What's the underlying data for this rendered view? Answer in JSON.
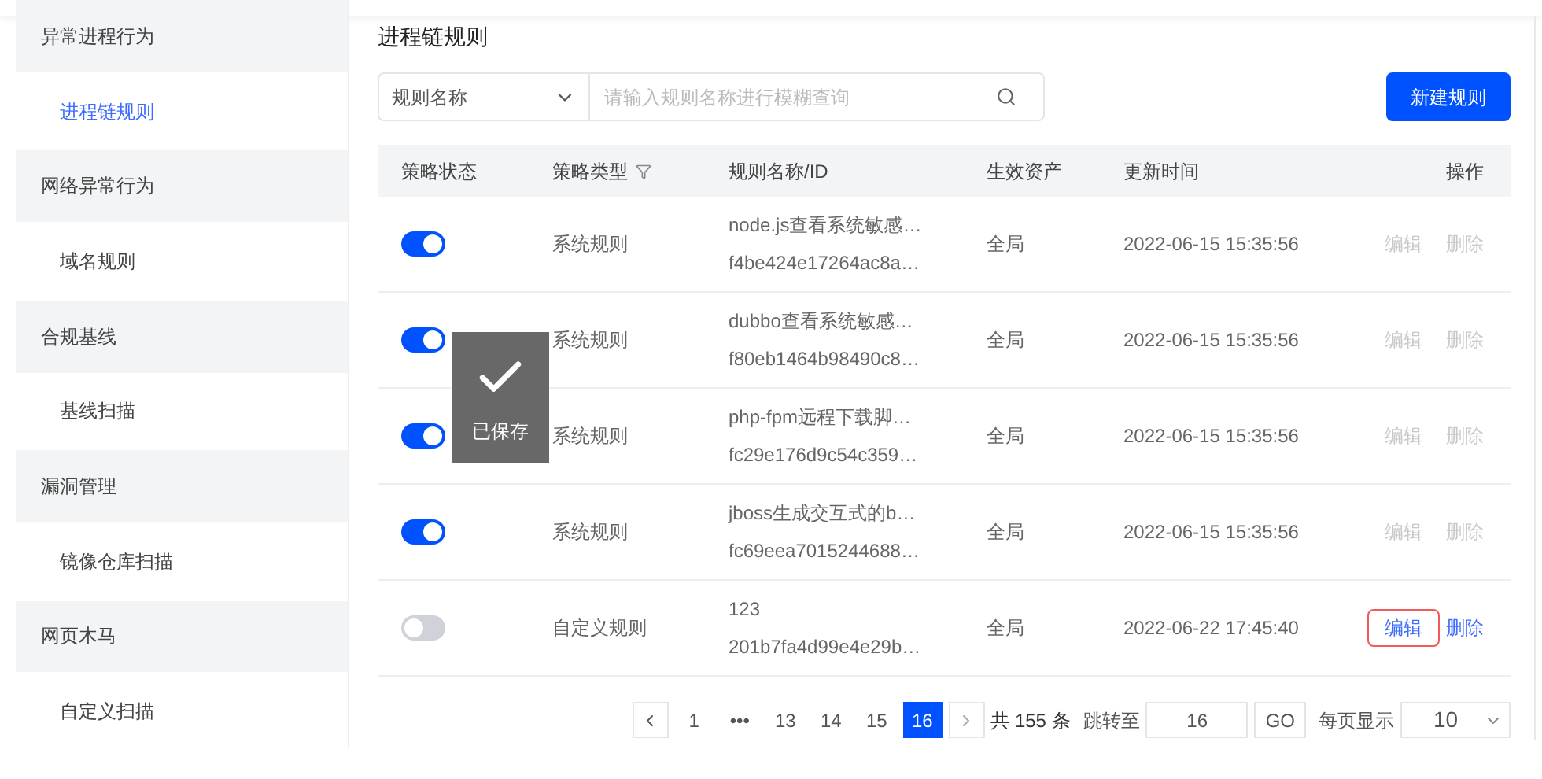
{
  "sidebar": {
    "items": [
      {
        "kind": "group",
        "label": "异常进程行为",
        "selected": false
      },
      {
        "kind": "child",
        "label": "进程链规则",
        "selected": true
      },
      {
        "kind": "group",
        "label": "网络异常行为",
        "selected": false
      },
      {
        "kind": "child",
        "label": "域名规则",
        "selected": false
      },
      {
        "kind": "group",
        "label": "合规基线",
        "selected": false
      },
      {
        "kind": "child",
        "label": "基线扫描",
        "selected": false
      },
      {
        "kind": "group",
        "label": "漏洞管理",
        "selected": false
      },
      {
        "kind": "child",
        "label": "镜像仓库扫描",
        "selected": false
      },
      {
        "kind": "group",
        "label": "网页木马",
        "selected": false
      },
      {
        "kind": "child",
        "label": "自定义扫描",
        "selected": false
      }
    ]
  },
  "page_title": "进程链规则",
  "filter": {
    "field": "规则名称",
    "placeholder": "请输入规则名称进行模糊查询"
  },
  "new_button": "新建规则",
  "table": {
    "columns": [
      "策略状态",
      "策略类型",
      "规则名称/ID",
      "生效资产",
      "更新时间",
      "操作"
    ],
    "rows": [
      {
        "on": true,
        "type": "系统规则",
        "name": "node.js查看系统敏感…",
        "id": "f4be424e17264ac8a…",
        "asset": "全局",
        "updated": "2022-06-15 15:35:56",
        "edit": "编辑",
        "delete": "删除",
        "disabled": true,
        "edit_focused": false
      },
      {
        "on": true,
        "type": "系统规则",
        "name": "dubbo查看系统敏感…",
        "id": "f80eb1464b98490c8…",
        "asset": "全局",
        "updated": "2022-06-15 15:35:56",
        "edit": "编辑",
        "delete": "删除",
        "disabled": true,
        "edit_focused": false
      },
      {
        "on": true,
        "type": "系统规则",
        "name": "php-fpm远程下载脚…",
        "id": "fc29e176d9c54c359…",
        "asset": "全局",
        "updated": "2022-06-15 15:35:56",
        "edit": "编辑",
        "delete": "删除",
        "disabled": true,
        "edit_focused": false
      },
      {
        "on": true,
        "type": "系统规则",
        "name": "jboss生成交互式的b…",
        "id": "fc69eea7015244688…",
        "asset": "全局",
        "updated": "2022-06-15 15:35:56",
        "edit": "编辑",
        "delete": "删除",
        "disabled": true,
        "edit_focused": false
      },
      {
        "on": false,
        "type": "自定义规则",
        "name": "123",
        "id": "201b7fa4d99e4e29b…",
        "asset": "全局",
        "updated": "2022-06-22 17:45:40",
        "edit": "编辑",
        "delete": "删除",
        "disabled": false,
        "edit_focused": true
      }
    ]
  },
  "pagination": {
    "pages": [
      {
        "label": "1",
        "selected": false
      },
      {
        "label": "•••",
        "selected": false
      },
      {
        "label": "13",
        "selected": false
      },
      {
        "label": "14",
        "selected": false
      },
      {
        "label": "15",
        "selected": false
      },
      {
        "label": "16",
        "selected": true
      }
    ],
    "total": "共 155 条",
    "jump_label": "跳转至",
    "jump_value": "16",
    "go": "GO",
    "page_size_label": "每页显示",
    "page_size": "10"
  },
  "toast": {
    "text": "已保存"
  }
}
